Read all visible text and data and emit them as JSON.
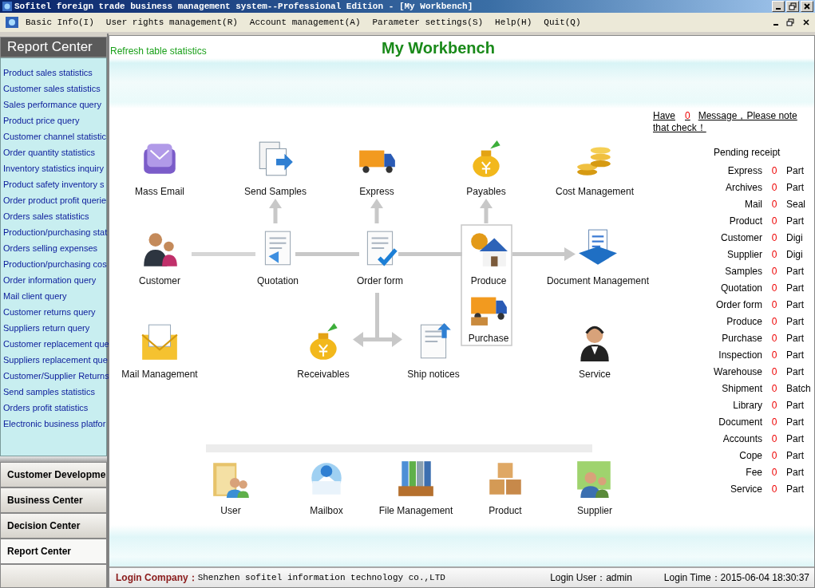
{
  "window": {
    "title": "Sofitel foreign trade business management system--Professional Edition - [My Workbench]"
  },
  "menu": [
    {
      "label": "Basic Info(I)"
    },
    {
      "label": "User rights management(R)"
    },
    {
      "label": "Account management(A)"
    },
    {
      "label": "Parameter settings(S)"
    },
    {
      "label": "Help(H)"
    },
    {
      "label": "Quit(Q)"
    }
  ],
  "sidebar": {
    "title": "Report Center",
    "items": [
      "Product sales statistics",
      "Customer sales statistics",
      "Sales performance query",
      "Product price query",
      "Customer channel statistic",
      "Order quantity statistics",
      "Inventory statistics inquiry",
      "Product safety inventory s",
      "Order product profit querie",
      "Orders sales statistics",
      "Production/purchasing stat",
      "Orders selling expenses",
      "Production/purchasing cos",
      "Order information query",
      "Mail client query",
      "Customer returns query",
      "Suppliers return query",
      "Customer replacement que",
      "Suppliers replacement que",
      "Customer/Supplier Returns",
      "Send samples statistics",
      "Orders profit statistics",
      "Electronic business platfor"
    ],
    "sections": [
      {
        "label": "Customer Developme",
        "selected": false
      },
      {
        "label": "Business Center",
        "selected": false
      },
      {
        "label": "Decision Center",
        "selected": false
      },
      {
        "label": "Report Center",
        "selected": true
      }
    ]
  },
  "workbench": {
    "refresh_link": "Refresh table statistics",
    "title": "My Workbench",
    "nodes": [
      {
        "label": "Mass Email"
      },
      {
        "label": "Send Samples"
      },
      {
        "label": "Express"
      },
      {
        "label": "Payables"
      },
      {
        "label": "Cost Management"
      },
      {
        "label": "Customer"
      },
      {
        "label": "Quotation"
      },
      {
        "label": "Order form"
      },
      {
        "label": "Produce"
      },
      {
        "label": "Document Management"
      },
      {
        "label": "Purchase"
      },
      {
        "label": "Mail Management"
      },
      {
        "label": "Receivables"
      },
      {
        "label": "Ship notices"
      },
      {
        "label": "Service"
      }
    ],
    "shortcuts": [
      {
        "label": "User"
      },
      {
        "label": "Mailbox"
      },
      {
        "label": "File Management"
      },
      {
        "label": "Product"
      },
      {
        "label": "Supplier"
      }
    ]
  },
  "notice": {
    "prefix": "Have",
    "count": "0",
    "text": "Message，Please note that check！"
  },
  "pending": {
    "title": "Pending receipt",
    "rows": [
      {
        "label": "Express",
        "count": "0",
        "unit": "Part"
      },
      {
        "label": "Archives",
        "count": "0",
        "unit": "Part"
      },
      {
        "label": "Mail",
        "count": "0",
        "unit": "Seal"
      },
      {
        "label": "Product",
        "count": "0",
        "unit": "Part"
      },
      {
        "label": "Customer",
        "count": "0",
        "unit": "Digi"
      },
      {
        "label": "Supplier",
        "count": "0",
        "unit": "Digi"
      },
      {
        "label": "Samples",
        "count": "0",
        "unit": "Part"
      },
      {
        "label": "Quotation",
        "count": "0",
        "unit": "Part"
      },
      {
        "label": "Order form",
        "count": "0",
        "unit": "Part"
      },
      {
        "label": "Produce",
        "count": "0",
        "unit": "Part"
      },
      {
        "label": "Purchase",
        "count": "0",
        "unit": "Part"
      },
      {
        "label": "Inspection",
        "count": "0",
        "unit": "Part"
      },
      {
        "label": "Warehouse",
        "count": "0",
        "unit": "Part"
      },
      {
        "label": "Shipment",
        "count": "0",
        "unit": "Batch"
      },
      {
        "label": "Library",
        "count": "0",
        "unit": "Part"
      },
      {
        "label": "Document",
        "count": "0",
        "unit": "Part"
      },
      {
        "label": "Accounts",
        "count": "0",
        "unit": "Part"
      },
      {
        "label": "Cope",
        "count": "0",
        "unit": "Part"
      },
      {
        "label": "Fee",
        "count": "0",
        "unit": "Part"
      },
      {
        "label": "Service",
        "count": "0",
        "unit": "Part"
      }
    ]
  },
  "status_bar": {
    "company_label": "Login Company：",
    "company": "Shenzhen sofitel information technology co.,LTD",
    "user_label": "Login User：",
    "user": "admin",
    "time_label": "Login Time：",
    "time": "2015-06-04 18:30:37"
  }
}
